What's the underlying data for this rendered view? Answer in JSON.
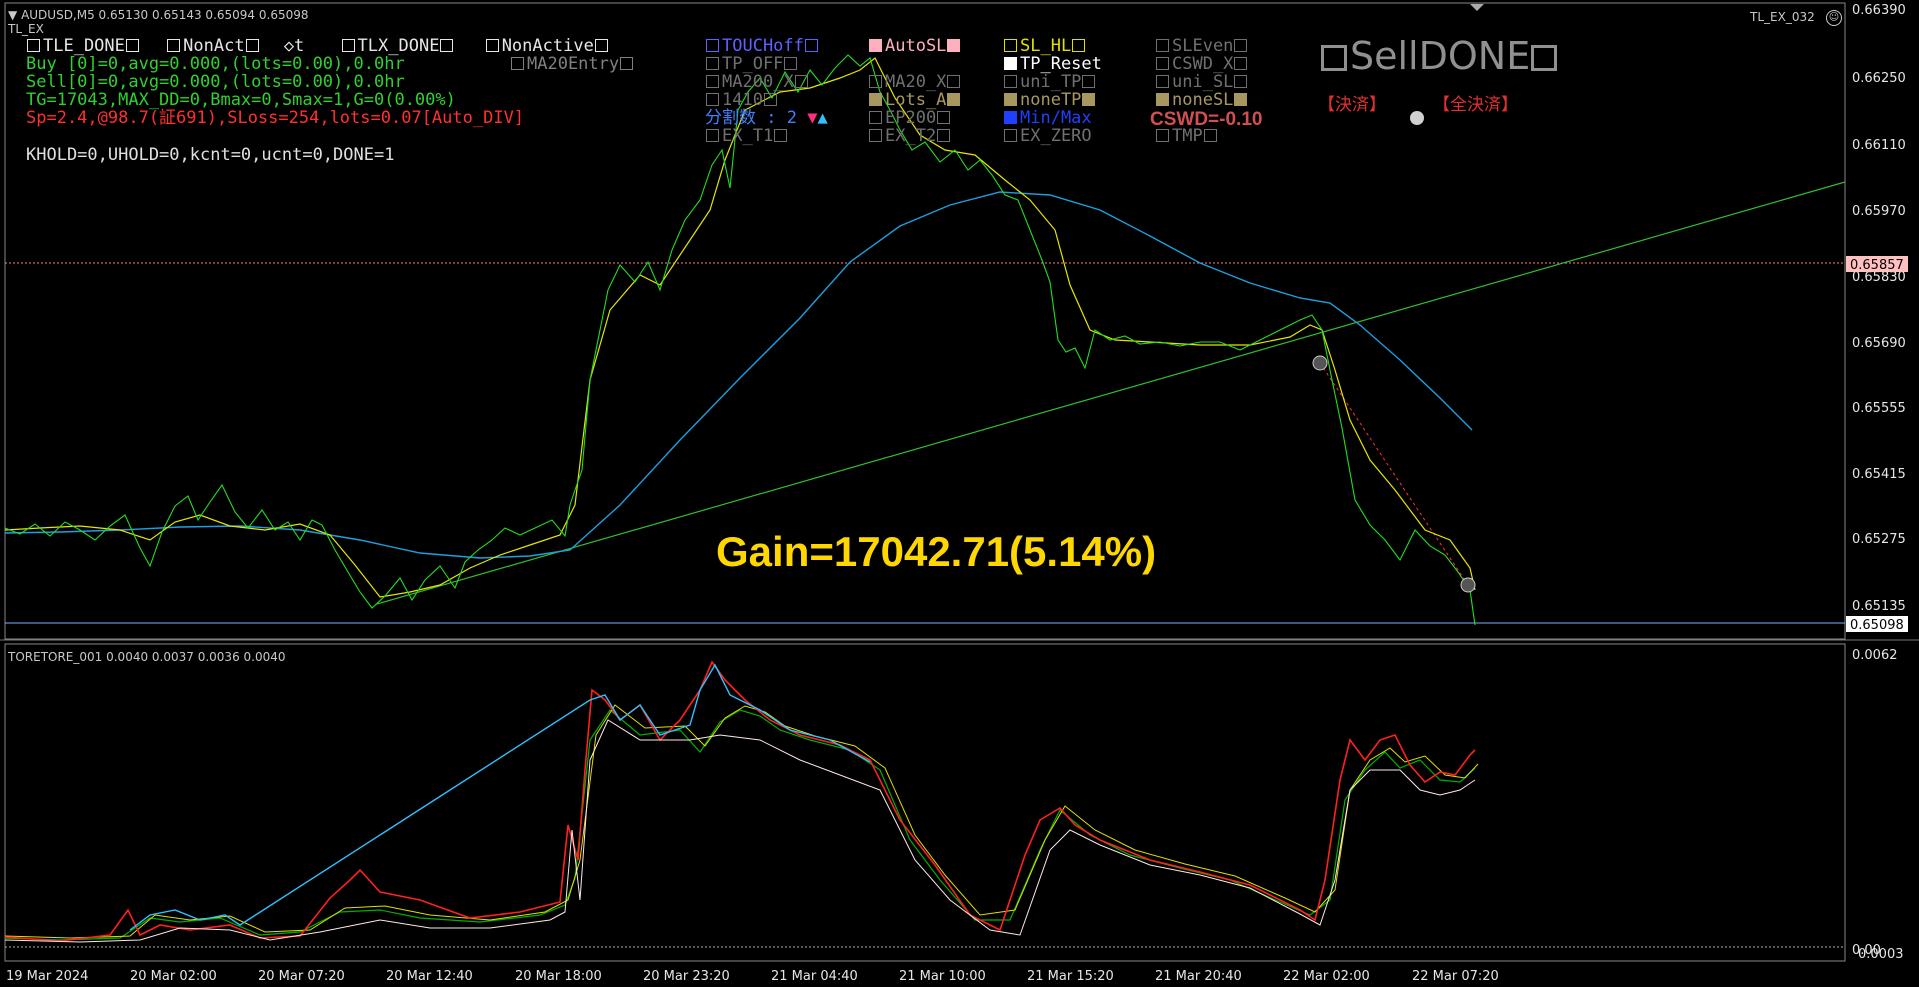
{
  "symbol_header": "AUDUSD,M5  0.65130 0.65143 0.65094 0.65098",
  "ea_name": "TL_EX",
  "ea_right": "TL_EX_032",
  "status_left": {
    "row1": [
      "TLE_DONE",
      "NonAct",
      "◇t",
      "TLX_DONE",
      "NonActive"
    ],
    "row1b": "MA20Entry",
    "buy": "Buy [0]=0,avg=0.000,(lots=0.00),0.0hr",
    "sell": "Sell[0]=0,avg=0.000,(lots=0.00),0.0hr",
    "tg": "TG=17043,MAX_DD=0,Bmax=0,Smax=1,G=0(0.00%)",
    "sp": "Sp=2.4,@98.7(証691),SLoss=254,lots=0.07[Auto_DIV]",
    "khold": "KHOLD=0,UHOLD=0,kcnt=0,ucnt=0,DONE=1"
  },
  "panel_buttons": {
    "col1": [
      "TOUCHoff",
      "TP_OFF",
      "MA200_X",
      "1410",
      "分割数 : 2",
      "EX_T1"
    ],
    "col2": [
      "AutoSL",
      "TP_Reset",
      "MA20_X",
      "Lots_A",
      "EP200",
      "EX_T2"
    ],
    "col3": [
      "SL_HL",
      "TP_Reset",
      "uni_TP",
      "noneTP",
      "Min/Max",
      "EX_ZERO"
    ],
    "col4": [
      "SLEven",
      "CSWD_X",
      "uni_SL",
      "noneSL",
      "TMP"
    ],
    "cswd": "CSWD=-0.10"
  },
  "sell_done": "SellDONE",
  "settle": "【決済】",
  "settle_all": "【全決済】",
  "gain_text": "Gain=17042.71(5.14%)",
  "price_axis": [
    "0.66390",
    "0.66250",
    "0.66110",
    "0.65970",
    "0.65830",
    "0.65690",
    "0.65555",
    "0.65415",
    "0.65275",
    "0.65135"
  ],
  "price_tag_red": "0.65857",
  "price_tag_last": "0.65098",
  "sub_header": "TORETORE_001 0.0040 0.0037 0.0036 0.0040",
  "sub_axis_top": "0.0062",
  "sub_axis_bottom": "0.0003",
  "sub_axis_zero": "0.00",
  "time_axis": [
    "19 Mar 2024",
    "20 Mar 02:00",
    "20 Mar 07:20",
    "20 Mar 12:40",
    "20 Mar 18:00",
    "20 Mar 23:20",
    "21 Mar 04:40",
    "21 Mar 10:00",
    "21 Mar 15:20",
    "21 Mar 20:40",
    "22 Mar 02:00",
    "22 Mar 07:20"
  ],
  "colors": {
    "price": "#00cc00",
    "ma_fast": "#e6e600",
    "ma_slow": "#1e9fe0",
    "trend": "#2fbf2f",
    "gain": "#ffd700",
    "red_line": "#ff5050"
  },
  "chart_data": [
    {
      "type": "line",
      "title": "AUDUSD,M5",
      "x": [
        "19 Mar 2024",
        "20 Mar 02:00",
        "20 Mar 07:20",
        "20 Mar 12:40",
        "20 Mar 18:00",
        "20 Mar 23:20",
        "21 Mar 04:40",
        "21 Mar 10:00",
        "21 Mar 15:20",
        "21 Mar 20:40",
        "22 Mar 02:00",
        "22 Mar 07:20"
      ],
      "ylim": [
        0.651,
        0.664
      ],
      "series": [
        {
          "values": [
            0.6528,
            0.6529,
            0.6527,
            0.6515,
            0.6521,
            0.6528,
            0.6607,
            0.6624,
            0.6617,
            0.6575,
            0.6572,
            0.6579
          ]
        },
        {
          "values": [
            0.6528,
            0.6528,
            0.6527,
            0.652,
            0.6523,
            0.6528,
            0.6598,
            0.6618,
            0.6614,
            0.658,
            0.6573,
            0.6578
          ]
        },
        {
          "values": [
            0.6528,
            0.6529,
            0.6526,
            0.6524,
            0.6525,
            0.6527,
            0.6555,
            0.6592,
            0.6602,
            0.6592,
            0.658,
            0.6577
          ]
        }
      ]
    },
    {
      "type": "line",
      "title": "TORETORE_001",
      "x": [
        "19 Mar 2024",
        "20 Mar 02:00",
        "20 Mar 07:20",
        "20 Mar 12:40",
        "20 Mar 18:00",
        "20 Mar 23:20",
        "21 Mar 04:40",
        "21 Mar 10:00",
        "21 Mar 15:20",
        "21 Mar 20:40",
        "22 Mar 02:00",
        "22 Mar 07:20"
      ],
      "ylim": [
        0.0003,
        0.0062
      ],
      "series": [
        {
          "values": [
            0.0006,
            0.0006,
            0.0004,
            0.0015,
            0.001,
            0.0011,
            0.0045,
            0.0045,
            0.0006,
            0.0028,
            0.0009,
            0.004
          ]
        }
      ]
    }
  ]
}
